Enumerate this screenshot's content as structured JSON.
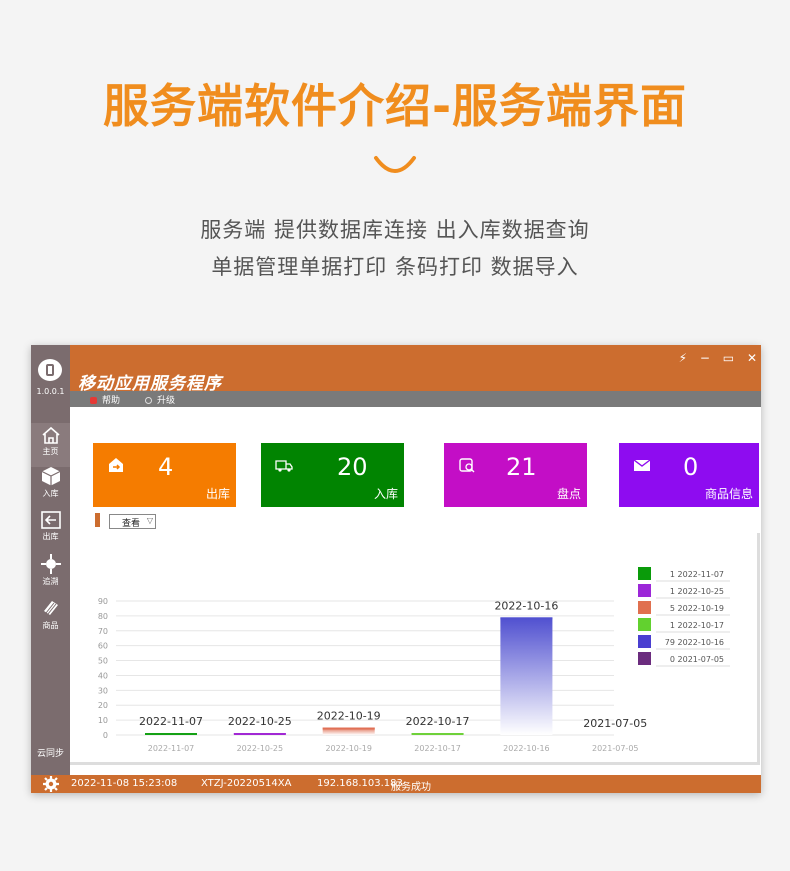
{
  "hero": {
    "title": "服务端软件介绍-服务端界面",
    "subtitle_line1": "服务端 提供数据库连接 出入库数据查询",
    "subtitle_line2": "单据管理单据打印 条码打印 数据导入"
  },
  "app": {
    "version": "1.0.0.1",
    "title": "移动应用服务程序",
    "window_controls": [
      "⚡",
      "−",
      "▭",
      "✕"
    ],
    "menu": [
      {
        "label": "帮助",
        "icon": "help-icon"
      },
      {
        "label": "升级",
        "icon": "upgrade-icon"
      }
    ],
    "sidebar": [
      {
        "label": "主页",
        "icon": "home-icon",
        "active": true
      },
      {
        "label": "入库",
        "icon": "box-icon"
      },
      {
        "label": "出库",
        "icon": "exit-icon"
      },
      {
        "label": "追溯",
        "icon": "trace-icon"
      },
      {
        "label": "商品",
        "icon": "goods-icon"
      }
    ],
    "cloud_sync": "云同步",
    "cards": [
      {
        "value": "4",
        "label": "出库",
        "color": "#f57c00",
        "icon": "outbound-icon"
      },
      {
        "value": "20",
        "label": "入库",
        "color": "#018401",
        "icon": "truck-icon"
      },
      {
        "value": "21",
        "label": "盘点",
        "color": "#c30ec6",
        "icon": "inventory-icon"
      },
      {
        "value": "0",
        "label": "商品信息",
        "color": "#8e0cf0",
        "icon": "mail-icon"
      }
    ],
    "view_select": "查看",
    "status": {
      "datetime": "2022-11-08 15:23:08",
      "device_id": "XTZJ-20220514XA",
      "ip": "192.168.103.183",
      "message": "服务成功"
    }
  },
  "chart_data": {
    "type": "bar",
    "categories": [
      "2022-11-07",
      "2022-10-25",
      "2022-10-19",
      "2022-10-17",
      "2022-10-16",
      "2021-07-05"
    ],
    "values": [
      1,
      1,
      5,
      1,
      79,
      0
    ],
    "colors": [
      "#15a115",
      "#a128d4",
      "#e07055",
      "#6fd13a",
      "#5050d0",
      "#6a2a80"
    ],
    "legend": [
      {
        "label": "1 2022-11-07",
        "color": "#0a9b0a"
      },
      {
        "label": "1 2022-10-25",
        "color": "#9c27d8"
      },
      {
        "label": "5 2022-10-19",
        "color": "#e0704f"
      },
      {
        "label": "1 2022-10-17",
        "color": "#62d12f"
      },
      {
        "label": "79 2022-10-16",
        "color": "#4a3fd0"
      },
      {
        "label": "0 2021-07-05",
        "color": "#6b2c7e"
      }
    ],
    "yticks": [
      0,
      10,
      20,
      30,
      40,
      50,
      60,
      70,
      80,
      90
    ],
    "ylim": [
      0,
      90
    ],
    "grid": true,
    "legend_position": "right"
  }
}
